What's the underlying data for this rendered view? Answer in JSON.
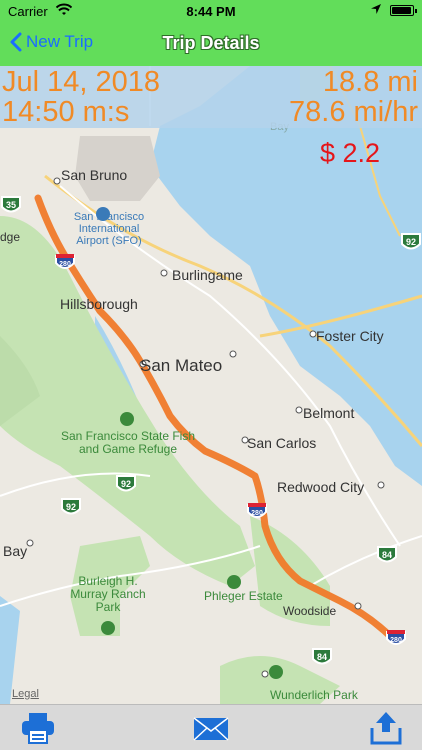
{
  "status_bar": {
    "carrier": "Carrier",
    "time": "8:44 PM",
    "battery_level": 0.95
  },
  "nav": {
    "back_label": "New Trip",
    "title": "Trip Details"
  },
  "trip": {
    "date": "Jul 14, 2018",
    "duration": "14:50 m:s",
    "distance": "18.8 mi",
    "speed": "78.6 mi/hr",
    "cost": "$ 2.2"
  },
  "map": {
    "places": {
      "san_bruno": "San Bruno",
      "sfo": "San Francisco International Airport (SFO)",
      "burlingame": "Burlingame",
      "hillsborough": "Hillsborough",
      "san_mateo": "San Mateo",
      "foster_city": "Foster City",
      "belmont": "Belmont",
      "san_carlos": "San Carlos",
      "redwood_city": "Redwood City",
      "fish_game_refuge": "San Francisco State Fish and Game Refuge",
      "burleigh_park": "Burleigh H. Murray Ranch Park",
      "phleger": "Phleger Estate",
      "woodside": "Woodside",
      "wunderlich": "Wunderlich Park",
      "bay": "Bay",
      "edge_label": "dge",
      "bay_water": "Bay"
    },
    "shields": {
      "r35": "35",
      "r92a": "92",
      "r92b": "92",
      "r92c": "92",
      "r84a": "84",
      "r84b": "84",
      "i280a": "280",
      "i280b": "280",
      "i280c": "280"
    },
    "legal": "Legal",
    "colors": {
      "route": "#f07a2a",
      "water": "#a8d3ee",
      "park": "#c5e3b3",
      "land": "#ece9e2"
    }
  },
  "toolbar": {
    "print_icon": "printer-icon",
    "mail_icon": "mail-icon",
    "share_icon": "share-icon"
  }
}
